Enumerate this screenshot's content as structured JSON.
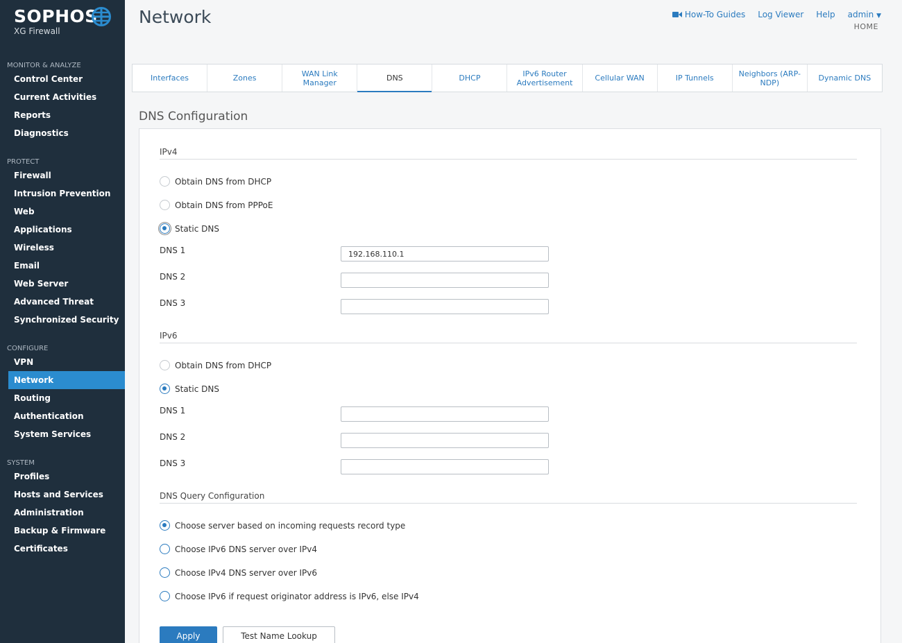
{
  "brand": {
    "name": "SOPHOS",
    "product": "XG Firewall",
    "globe_icon": "globe-icon"
  },
  "page": {
    "title": "Network"
  },
  "header": {
    "how_to": "How-To Guides",
    "log_viewer": "Log Viewer",
    "help": "Help",
    "admin": "admin",
    "crumb": "HOME"
  },
  "sidebar": {
    "sections": [
      {
        "heading": "MONITOR & ANALYZE",
        "items": [
          "Control Center",
          "Current Activities",
          "Reports",
          "Diagnostics"
        ]
      },
      {
        "heading": "PROTECT",
        "items": [
          "Firewall",
          "Intrusion Prevention",
          "Web",
          "Applications",
          "Wireless",
          "Email",
          "Web Server",
          "Advanced Threat",
          "Synchronized Security"
        ]
      },
      {
        "heading": "CONFIGURE",
        "items": [
          "VPN",
          "Network",
          "Routing",
          "Authentication",
          "System Services"
        ]
      },
      {
        "heading": "SYSTEM",
        "items": [
          "Profiles",
          "Hosts and Services",
          "Administration",
          "Backup & Firmware",
          "Certificates"
        ]
      }
    ],
    "active": "Network"
  },
  "tabs": [
    "Interfaces",
    "Zones",
    "WAN Link Manager",
    "DNS",
    "DHCP",
    "IPv6 Router Advertisement",
    "Cellular WAN",
    "IP Tunnels",
    "Neighbors (ARP-NDP)",
    "Dynamic DNS"
  ],
  "active_tab": "DNS",
  "dns": {
    "section_title": "DNS Configuration",
    "ipv4": {
      "label": "IPv4",
      "opt_dhcp": "Obtain DNS from DHCP",
      "opt_pppoe": "Obtain DNS from PPPoE",
      "opt_static": "Static DNS",
      "dns1_label": "DNS 1",
      "dns1_value": "192.168.110.1",
      "dns2_label": "DNS 2",
      "dns2_value": "",
      "dns3_label": "DNS 3",
      "dns3_value": ""
    },
    "ipv6": {
      "label": "IPv6",
      "opt_dhcp": "Obtain DNS from DHCP",
      "opt_static": "Static DNS",
      "dns1_label": "DNS 1",
      "dns1_value": "",
      "dns2_label": "DNS 2",
      "dns2_value": "",
      "dns3_label": "DNS 3",
      "dns3_value": ""
    },
    "query": {
      "label": "DNS Query Configuration",
      "opt1": "Choose server based on incoming requests record type",
      "opt2": "Choose IPv6 DNS server over IPv4",
      "opt3": "Choose IPv4 DNS server over IPv6",
      "opt4": "Choose IPv6 if request originator address is IPv6, else IPv4"
    },
    "apply": "Apply",
    "test_lookup": "Test Name Lookup"
  }
}
